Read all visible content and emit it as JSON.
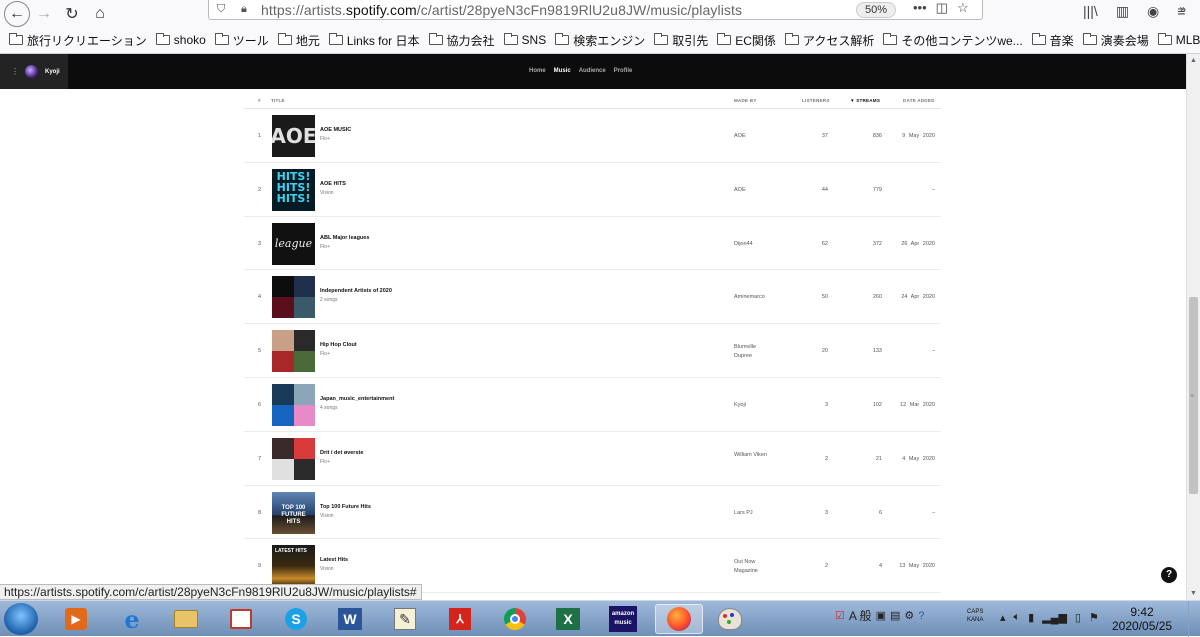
{
  "browser": {
    "url_prefix": "https://artists.",
    "url_domain": "spotify.com",
    "url_path": "/c/artist/28pyeN3cFn9819RlU2u8JW/music/playlists",
    "zoom": "50%",
    "bookmarks": [
      "旅行リクリエーション",
      "shoko",
      "ツール",
      "地元",
      "Links for 日本",
      "協力会社",
      "SNS",
      "検索エンジン",
      "取引先",
      "EC関係",
      "アクセス解析",
      "その他コンテンツwe...",
      "音楽",
      "演奏会場",
      "MLB"
    ],
    "more": "»",
    "status_url": "https://artists.spotify.com/c/artist/28pyeN3cFn9819RlU2u8JW/music/playlists#"
  },
  "app": {
    "artist_name": "Kyoji",
    "tabs": [
      {
        "label": "Home",
        "active": false
      },
      {
        "label": "Music",
        "active": true
      },
      {
        "label": "Audience",
        "active": false
      },
      {
        "label": "Profile",
        "active": false
      }
    ]
  },
  "table": {
    "headers": {
      "num": "#",
      "title": "Title",
      "made_by": "Made by",
      "listeners": "Listeners",
      "streams": "▼ Streams",
      "date_added": "Date added"
    },
    "rows": [
      {
        "num": "1",
        "name": "AOE MUSIC",
        "sub": "Flo+",
        "made_by": "AOE",
        "listeners": "37",
        "streams": "836",
        "date": "9 May 2020",
        "cover_text": "AOE"
      },
      {
        "num": "2",
        "name": "AOE HITS",
        "sub": "Vision",
        "made_by": "AOE",
        "listeners": "44",
        "streams": "779",
        "date": "–",
        "cover_text": "HITS! HITS! HITS!"
      },
      {
        "num": "3",
        "name": "ABL Major leagues",
        "sub": "Flo+",
        "made_by": "Dijon44",
        "listeners": "62",
        "streams": "372",
        "date": "26 Apr 2020",
        "cover_text": "league"
      },
      {
        "num": "4",
        "name": "Independent Artists of 2020",
        "sub": "2 songs",
        "made_by": "Aminemarco",
        "listeners": "50",
        "streams": "260",
        "date": "24 Apr 2020",
        "cover_text": ""
      },
      {
        "num": "5",
        "name": "Hip Hop Clout",
        "sub": "Flo+",
        "made_by": "Blumville Dupree",
        "listeners": "20",
        "streams": "133",
        "date": "–",
        "cover_text": ""
      },
      {
        "num": "6",
        "name": "Japan_music_entertainment",
        "sub": "4 songs",
        "made_by": "Kyoji",
        "listeners": "3",
        "streams": "102",
        "date": "12 Mar 2020",
        "cover_text": ""
      },
      {
        "num": "7",
        "name": "Drit i det øverste",
        "sub": "Flo+",
        "made_by": "William Viken",
        "listeners": "2",
        "streams": "21",
        "date": "4 May 2020",
        "cover_text": ""
      },
      {
        "num": "8",
        "name": "Top 100 Future Hits",
        "sub": "Vision",
        "made_by": "Lars PJ",
        "listeners": "3",
        "streams": "6",
        "date": "–",
        "cover_text": "TOP 100 FUTURE HITS"
      },
      {
        "num": "9",
        "name": "Latest Hits",
        "sub": "Vision",
        "made_by": "Out Now Magazine",
        "listeners": "2",
        "streams": "4",
        "date": "13 May 2020",
        "cover_text": "LATEST HITS"
      }
    ]
  },
  "taskbar": {
    "caps": "CAPS",
    "kana": "KANA",
    "ime": "A 般",
    "time": "9:42",
    "date": "2020/05/25",
    "amazon_label": "amazon music"
  },
  "help_label": "?"
}
